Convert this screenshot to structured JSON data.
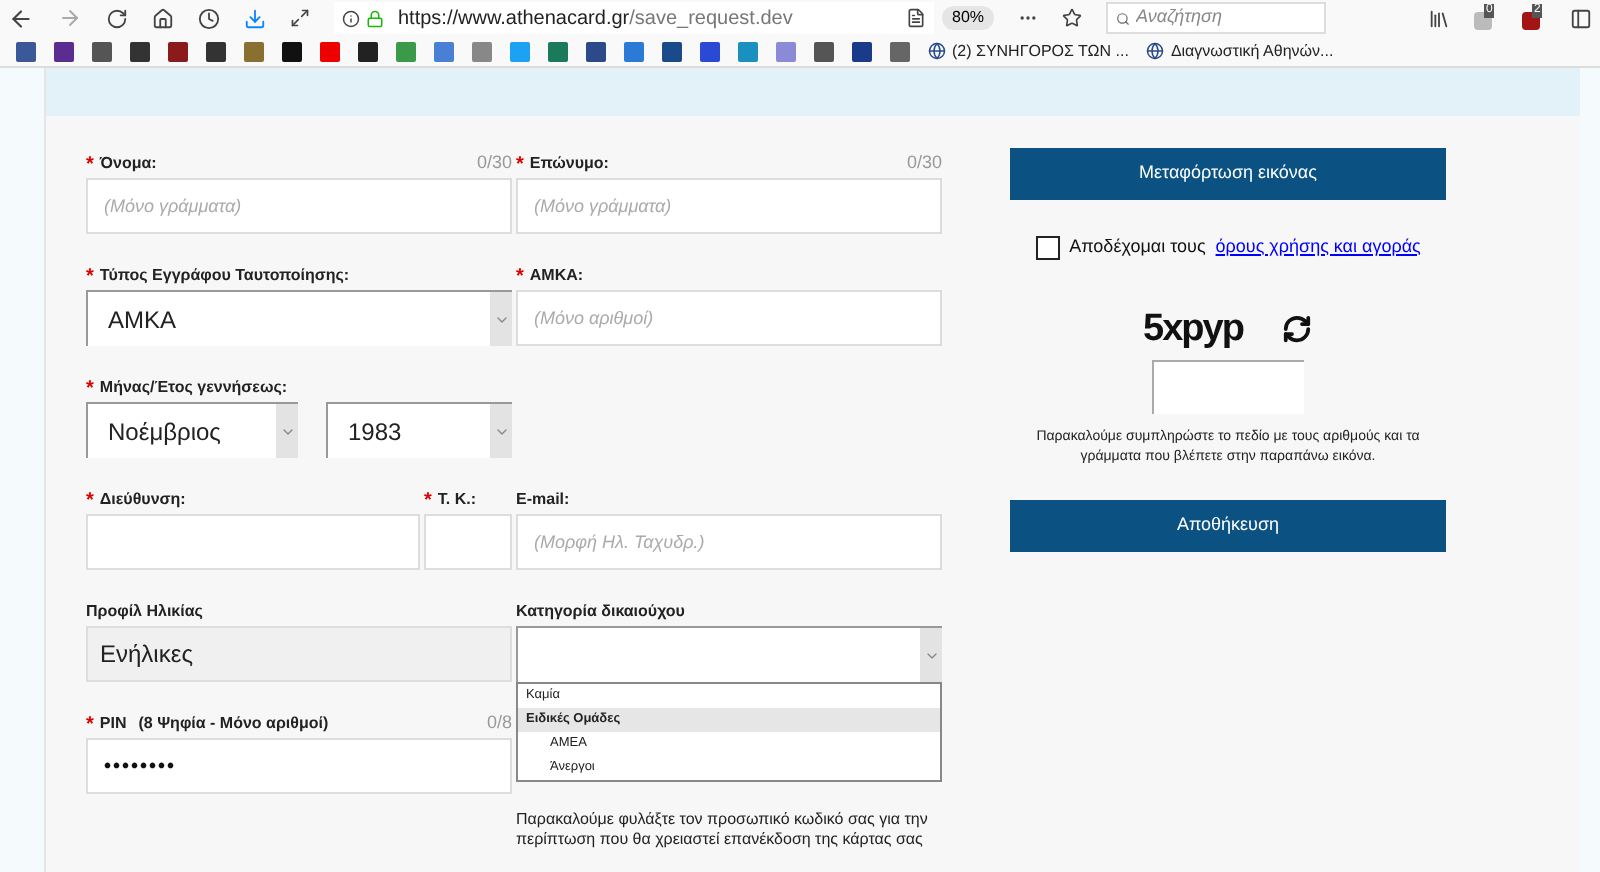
{
  "browser": {
    "url_host": "https://www.athenacard.gr",
    "url_path": "/save_request.dev",
    "zoom": "80%",
    "search": {
      "placeholder": "Αναζήτηση"
    },
    "badges": [
      "0",
      "2"
    ]
  },
  "bookmarks": [
    {
      "label": "(2) ΣΥΝΗΓΟΡΟΣ ΤΩΝ ..."
    },
    {
      "label": "Διαγνωστική Αθηνών..."
    }
  ],
  "form": {
    "rows": [
      [
        {
          "kind": "input",
          "label": "Όνομα:",
          "marker": "*",
          "counter": "0/30",
          "placeholder": "(Μόνο γράμματα)"
        },
        {
          "kind": "input",
          "label": "Επώνυμο:",
          "marker": "*",
          "counter": "0/30",
          "placeholder": "(Μόνο γράμματα)"
        }
      ],
      [
        {
          "kind": "select",
          "label": "Τύπος Εγγράφου Ταυτοποίησης:",
          "marker": "*",
          "value": "ΑΜΚΑ"
        },
        {
          "kind": "input",
          "label": "ΑΜΚΑ:",
          "marker": "*",
          "placeholder": "(Μόνο αριθμοί)"
        }
      ],
      [
        {
          "kind": "selectpair",
          "label": "Μήνας/Έτος γεννήσεως:",
          "marker": "*",
          "values": [
            "Νοέμβριος",
            "1983"
          ]
        }
      ],
      [
        {
          "kind": "input",
          "label": "Διεύθυνση:",
          "marker": "*"
        },
        {
          "kind": "input",
          "label": "Τ. Κ.:",
          "marker": "*"
        },
        {
          "kind": "input",
          "label": "E-mail:",
          "placeholder": "(Μορφή Ηλ. Ταχυδρ.)"
        }
      ],
      [
        {
          "kind": "readonly",
          "label": "Προφίλ Ηλικίας",
          "value": "Ενήλικες"
        },
        {
          "kind": "dropdown",
          "label": "Κατηγορία δικαιούχου",
          "expanded": true,
          "options": [
            {
              "label": "Καμία",
              "selected": false
            },
            {
              "label": "Ειδικές Ομάδες",
              "selected": true,
              "children": [
                {
                  "label": "ΑΜΕΑ",
                  "selected": false
                },
                {
                  "label": "Άνεργοι",
                  "selected": false
                }
              ]
            }
          ]
        }
      ],
      [
        {
          "kind": "password",
          "label": "PIN",
          "hint": "(8 Ψηφία - Μόνο αριθμοί)",
          "marker": "*",
          "counter": "0/8",
          "value": "••••••••"
        }
      ]
    ],
    "pin_note": "Παρακαλούμε φυλάξτε τον προσωπικό κωδικό σας για την περίπτωση που θα χρειαστεί επανέκδοση της κάρτας σας"
  },
  "side": {
    "upload_button": "Μεταφόρτωση εικόνας",
    "terms": {
      "checked": false,
      "text": "Αποδέχομαι τους",
      "link": "όρους χρήσης και αγοράς"
    },
    "captcha": {
      "code": "5xpyp",
      "note": "Παρακαλούμε συμπληρώστε το πεδίο με τους αριθμούς και τα γράμματα που βλέπετε στην παραπάνω εικόνα."
    },
    "save_button": "Αποθήκευση"
  }
}
